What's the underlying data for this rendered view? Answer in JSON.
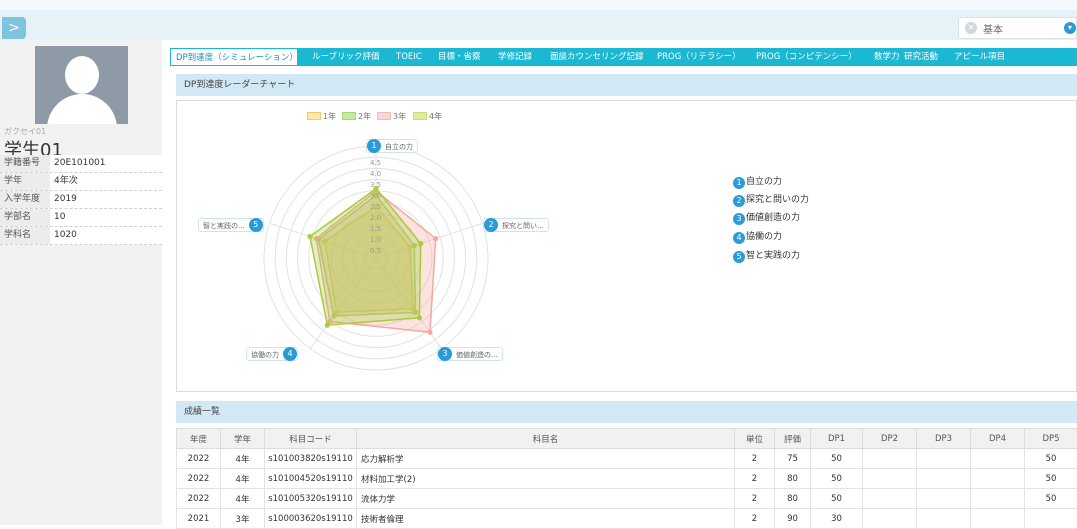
{
  "header": {
    "expand_icon": ">",
    "select_value": "基本",
    "clear_icon": "×",
    "dropdown_icon": "▾"
  },
  "student": {
    "kana": "ガクセイ01",
    "name": "学生01",
    "fields": [
      {
        "label": "学籍番号",
        "value": "20E101001"
      },
      {
        "label": "学年",
        "value": "4年次"
      },
      {
        "label": "入学年度",
        "value": "2019"
      },
      {
        "label": "学部名",
        "value": "10"
      },
      {
        "label": "学科名",
        "value": "1020"
      }
    ]
  },
  "tabs": [
    "DP到達度（シミュレーション）",
    "ルーブリック評価",
    "TOEIC",
    "目標・省察",
    "学修記録",
    "面談カウンセリング記録",
    "PROG（リテラシー）",
    "PROG（コンピテンシー）",
    "数学力",
    "研究活動",
    "アピール項目"
  ],
  "radar_section": {
    "title": "DP到達度レーダーチャート",
    "legend": [
      {
        "label": "1年",
        "color": "#f7c76a"
      },
      {
        "label": "2年",
        "color": "#a8d86e"
      },
      {
        "label": "3年",
        "color": "#f6b8b8"
      },
      {
        "label": "4年",
        "color": "#c9e07a"
      }
    ],
    "axes_short": [
      "自立の力",
      "探究と問い...",
      "価値創造の...",
      "協働の力",
      "智と実践の..."
    ],
    "axes_full": [
      "自立の力",
      "探究と問いの力",
      "価値創造の力",
      "協働の力",
      "智と実践の力"
    ],
    "ticks": [
      "4.5",
      "4.0",
      "3.5",
      "3.0",
      "2.5",
      "2.0",
      "1.5",
      "1.0",
      "0.5"
    ]
  },
  "chart_data": {
    "type": "radar",
    "axes": [
      "自立の力",
      "探究と問いの力",
      "価値創造の力",
      "協働の力",
      "智と実践の力"
    ],
    "range": [
      0,
      5
    ],
    "series": [
      {
        "name": "1年",
        "values": [
          2.3,
          1.6,
          2.8,
          3.0,
          2.4
        ],
        "color": "#f2c45a"
      },
      {
        "name": "2年",
        "values": [
          2.8,
          1.8,
          3.0,
          3.2,
          2.7
        ],
        "color": "#9ed25e"
      },
      {
        "name": "3年",
        "values": [
          3.0,
          2.8,
          4.1,
          3.5,
          2.8
        ],
        "color": "#f3a9a0"
      },
      {
        "name": "4年",
        "values": [
          3.1,
          2.1,
          3.3,
          3.7,
          3.1
        ],
        "color": "#a8cc3c"
      }
    ]
  },
  "grades": {
    "title": "成績一覧",
    "columns": [
      "年度",
      "学年",
      "科目コード",
      "科目名",
      "単位",
      "評価",
      "DP1",
      "DP2",
      "DP3",
      "DP4",
      "DP5"
    ],
    "rows": [
      [
        "2022",
        "4年",
        "s101003820s19110",
        "応力解析学",
        "2",
        "75",
        "50",
        "",
        "",
        "",
        "50"
      ],
      [
        "2022",
        "4年",
        "s101004520s19110",
        "材料加工学(2)",
        "2",
        "80",
        "50",
        "",
        "",
        "",
        "50"
      ],
      [
        "2022",
        "4年",
        "s101005320s19110",
        "流体力学",
        "2",
        "80",
        "50",
        "",
        "",
        "",
        "50"
      ],
      [
        "2021",
        "3年",
        "s100003620s19110",
        "技術者倫理",
        "2",
        "90",
        "30",
        "",
        "",
        "",
        ""
      ]
    ]
  }
}
